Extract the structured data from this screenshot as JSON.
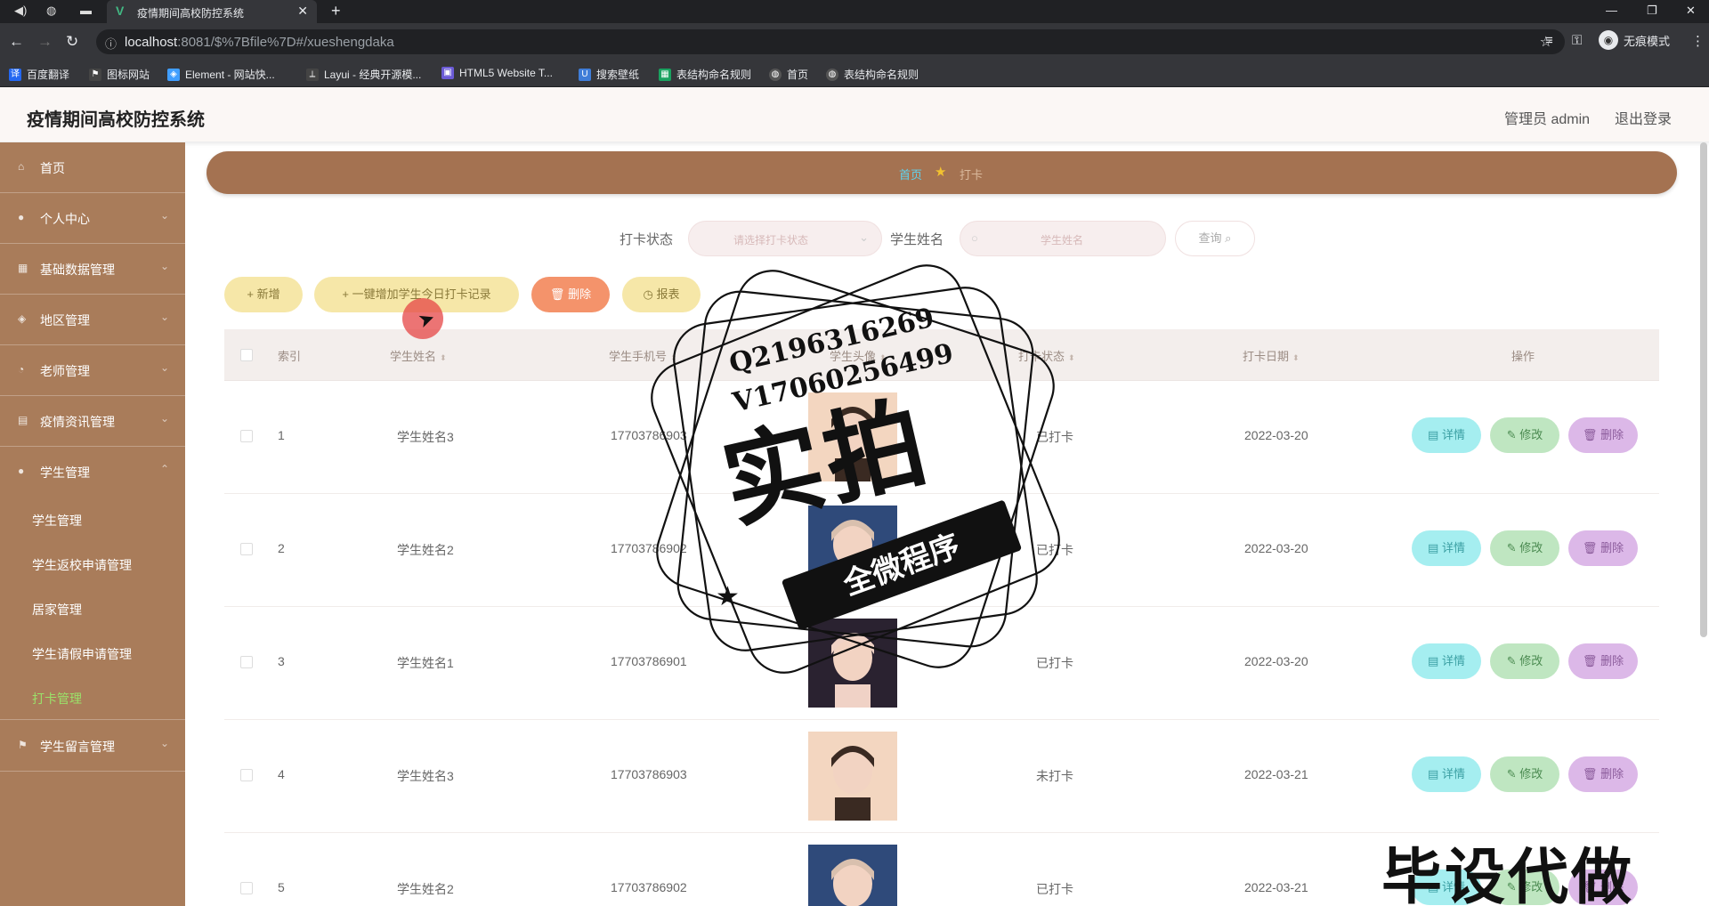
{
  "browser": {
    "tab_title": "疫情期间高校防控系统",
    "url_host": "localhost",
    "url_rest": ":8081/$%7Bfile%7D#/xueshengdaka",
    "incognito_label": "无痕模式",
    "bookmarks": [
      "百度翻译",
      "图标网站",
      "Element - 网站快...",
      "Layui - 经典开源模...",
      "HTML5 Website T...",
      "搜索壁纸",
      "表结构命名规则",
      "首页",
      "表结构命名规则"
    ]
  },
  "header": {
    "title": "疫情期间高校防控系统",
    "admin": "管理员 admin",
    "logout": "退出登录"
  },
  "sidebar": {
    "items": [
      {
        "label": "首页"
      },
      {
        "label": "个人中心"
      },
      {
        "label": "基础数据管理"
      },
      {
        "label": "地区管理"
      },
      {
        "label": "老师管理"
      },
      {
        "label": "疫情资讯管理"
      },
      {
        "label": "学生管理"
      }
    ],
    "sub_items": [
      {
        "label": "学生管理"
      },
      {
        "label": "学生返校申请管理"
      },
      {
        "label": "居家管理"
      },
      {
        "label": "学生请假申请管理"
      },
      {
        "label": "打卡管理"
      }
    ],
    "last_item": {
      "label": "学生留言管理"
    }
  },
  "breadcrumb": {
    "home": "首页",
    "current": "打卡"
  },
  "search": {
    "status_label": "打卡状态",
    "status_placeholder": "请选择打卡状态",
    "name_label": "学生姓名",
    "name_placeholder": "学生姓名",
    "query_label": "查询"
  },
  "actions": {
    "add": "+ 新增",
    "one_click": "+ 一键增加学生今日打卡记录",
    "delete": "删除",
    "report": "报表"
  },
  "table": {
    "columns": [
      "索引",
      "学生姓名",
      "学生手机号",
      "学生头像",
      "打卡状态",
      "打卡日期",
      "操作"
    ],
    "rows": [
      {
        "index": "1",
        "name": "学生姓名3",
        "phone": "17703786903",
        "status": "已打卡",
        "date": "2022-03-20"
      },
      {
        "index": "2",
        "name": "学生姓名2",
        "phone": "17703786902",
        "status": "已打卡",
        "date": "2022-03-20"
      },
      {
        "index": "3",
        "name": "学生姓名1",
        "phone": "17703786901",
        "status": "已打卡",
        "date": "2022-03-20"
      },
      {
        "index": "4",
        "name": "学生姓名3",
        "phone": "17703786903",
        "status": "未打卡",
        "date": "2022-03-21"
      },
      {
        "index": "5",
        "name": "学生姓名2",
        "phone": "17703786902",
        "status": "已打卡",
        "date": "2022-03-21"
      }
    ],
    "row_buttons": {
      "detail": "详情",
      "edit": "修改",
      "delete": "删除"
    }
  },
  "watermark": {
    "line1": "Q2196316269",
    "line2": "V17060256499",
    "big": "实拍",
    "band": "全微程序",
    "corner": "毕设代做"
  },
  "colors": {
    "sidebar": "#a97c5a",
    "breadcrumb_bar": "#a47251",
    "active_menu": "#9be26a",
    "detail_btn": "#a5eef0",
    "edit_btn": "#bfe6c1",
    "delete_btn": "#dcb8e8"
  }
}
